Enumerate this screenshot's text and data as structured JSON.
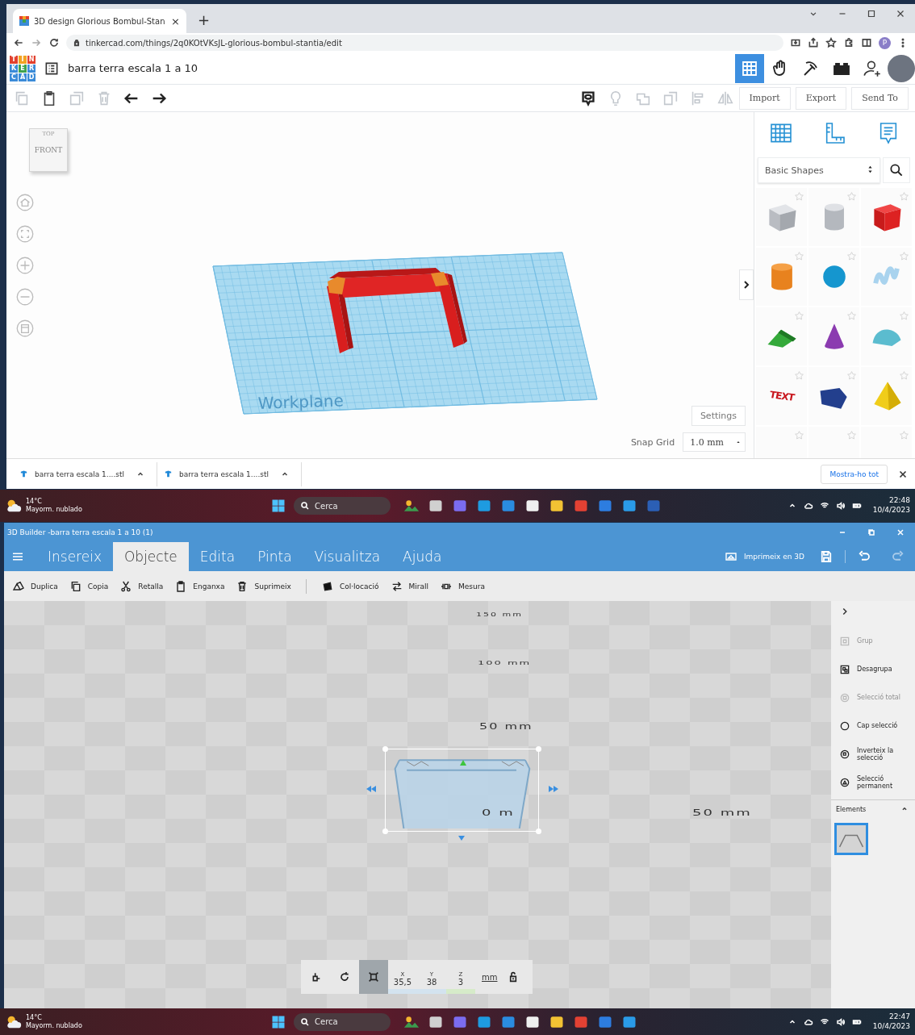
{
  "browser": {
    "tab": {
      "title": "3D design Glorious Bombul-Stan",
      "selected": true,
      "close": "×"
    },
    "new_tab": "+",
    "url": "tinkercad.com/things/2q0KOtVKsJL-glorious-bombul-stantia/edit",
    "profile_initial": "P"
  },
  "tinkercad": {
    "logo": [
      {
        "letter": "T",
        "color": "#e2412e"
      },
      {
        "letter": "I",
        "color": "#f3a322"
      },
      {
        "letter": "N",
        "color": "#e2412e"
      },
      {
        "letter": "K",
        "color": "#3b8bd8"
      },
      {
        "letter": "E",
        "color": "#3fa34d"
      },
      {
        "letter": "R",
        "color": "#3b8bd8"
      },
      {
        "letter": "C",
        "color": "#3b8bd8"
      },
      {
        "letter": "A",
        "color": "#3b8bd8"
      },
      {
        "letter": "D",
        "color": "#3b8bd8"
      }
    ],
    "design_title": "barra terra escala 1 a 10",
    "views": [
      {
        "kind": "grid",
        "selected": true
      },
      {
        "kind": "hand",
        "selected": false
      },
      {
        "kind": "pickaxe",
        "selected": false
      },
      {
        "kind": "bricks",
        "selected": false
      }
    ],
    "toolbar_buttons": [
      "Import",
      "Export",
      "Send To"
    ],
    "view_cube": {
      "top": "TOP",
      "front": "FRONT"
    },
    "workplane_label": "Workplane",
    "settings_button": "Settings",
    "snap_grid": {
      "label": "Snap Grid",
      "value": "1.0 mm"
    },
    "shape_library": "Basic Shapes",
    "shapes": [
      {
        "kind": "box-hole"
      },
      {
        "kind": "cylinder-hole"
      },
      {
        "kind": "box"
      },
      {
        "kind": "cylinder"
      },
      {
        "kind": "sphere"
      },
      {
        "kind": "scribble"
      },
      {
        "kind": "roof"
      },
      {
        "kind": "cone"
      },
      {
        "kind": "round-roof"
      },
      {
        "kind": "text",
        "label": "TEXT"
      },
      {
        "kind": "polygon"
      },
      {
        "kind": "pyramid"
      },
      {
        "kind": "partial"
      },
      {
        "kind": "partial"
      },
      {
        "kind": "partial"
      }
    ]
  },
  "downloads": {
    "items": [
      "barra terra escala 1....stl",
      "barra terra escala 1....stl"
    ],
    "show_all": "Mostra-ho tot"
  },
  "builder": {
    "title": "3D Builder -barra terra escala 1 a 10 (1)",
    "tabs": [
      {
        "label": "Insereix",
        "selected": false
      },
      {
        "label": "Objecte",
        "selected": true
      },
      {
        "label": "Edita",
        "selected": false
      },
      {
        "label": "Pinta",
        "selected": false
      },
      {
        "label": "Visualitza",
        "selected": false
      },
      {
        "label": "Ajuda",
        "selected": false
      }
    ],
    "print_button": "Imprimeix en 3D",
    "tools": [
      {
        "kind": "duplicate",
        "label": "Duplica"
      },
      {
        "kind": "copy",
        "label": "Copia"
      },
      {
        "kind": "cut",
        "label": "Retalla"
      },
      {
        "kind": "paste",
        "label": "Enganxa"
      },
      {
        "kind": "delete",
        "label": "Suprimeix"
      }
    ],
    "tools_2": [
      {
        "kind": "placement",
        "label": "Col·locació"
      },
      {
        "kind": "mirror",
        "label": "Mirall"
      },
      {
        "kind": "measure",
        "label": "Mesura"
      }
    ],
    "rulers": [
      "150 mm",
      "100 mm",
      "50 mm",
      "0 m",
      "50 mm"
    ],
    "panel": [
      {
        "kind": "group",
        "label": "Grup",
        "disabled": true
      },
      {
        "kind": "ungroup",
        "label": "Desagrupa",
        "disabled": false
      },
      {
        "kind": "select-all",
        "label": "Selecció total",
        "disabled": true
      },
      {
        "kind": "select-none",
        "label": "Cap selecció",
        "disabled": false
      },
      {
        "kind": "invert",
        "label": "Inverteix la selecció",
        "disabled": false
      },
      {
        "kind": "sticky",
        "label": "Selecció permanent",
        "disabled": false
      }
    ],
    "elements_label": "Elements",
    "elements": [
      {
        "selected": true
      }
    ],
    "modes": [
      {
        "kind": "move",
        "selected": false
      },
      {
        "kind": "rotate",
        "selected": false
      },
      {
        "kind": "scale",
        "selected": true
      }
    ],
    "coords": [
      {
        "axis": "X",
        "value": "35,5",
        "color": "#d3e3ef"
      },
      {
        "axis": "Y",
        "value": "38",
        "color": "#d3e3ef"
      },
      {
        "axis": "Z",
        "value": "3",
        "color": "#d6ebc9"
      }
    ],
    "unit": "mm"
  },
  "taskbars": [
    {
      "temp": "14°C",
      "weather": "Mayorm. nublado",
      "placeholder": "Cerca",
      "time": "22:48",
      "date": "10/4/2023"
    },
    {
      "temp": "14°C",
      "weather": "Mayorm. nublado",
      "placeholder": "Cerca",
      "time": "22:47",
      "date": "10/4/2023"
    }
  ]
}
